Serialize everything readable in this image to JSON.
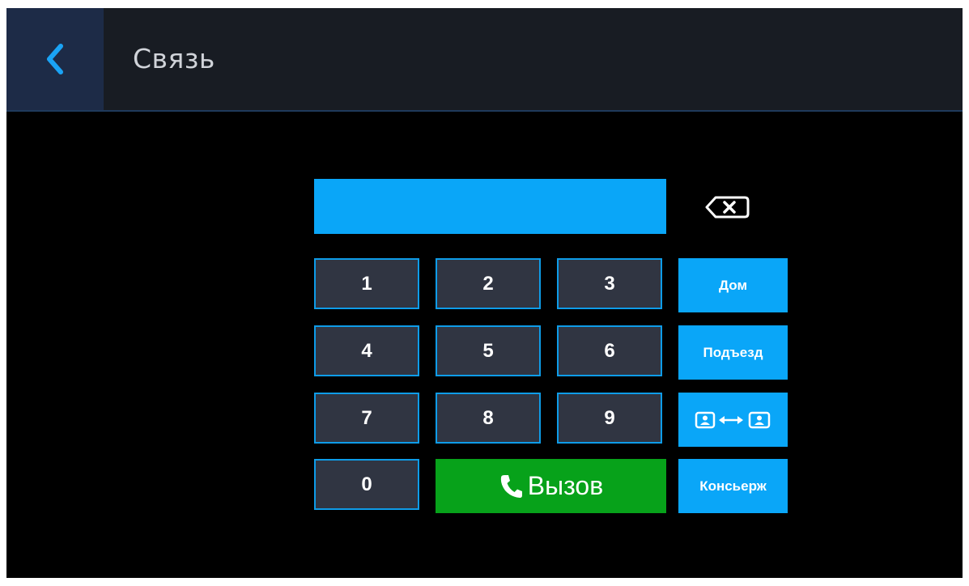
{
  "header": {
    "title": "Связь",
    "back_icon": "chevron-left-icon"
  },
  "input": {
    "value": ""
  },
  "keypad": {
    "keys": [
      "1",
      "2",
      "3",
      "4",
      "5",
      "6",
      "7",
      "8",
      "9",
      "0"
    ]
  },
  "side_buttons": {
    "house": "Дом",
    "entrance": "Подъезд",
    "switch_icon": "contacts-swap-icon",
    "concierge": "Консьерж"
  },
  "call": {
    "label": "Вызов",
    "icon": "phone-icon"
  },
  "colors": {
    "accent": "#0aa6f8",
    "call_green": "#07a21a",
    "key_bg": "#303542",
    "header_bg": "#181c23",
    "back_bg": "#1d2b47"
  }
}
